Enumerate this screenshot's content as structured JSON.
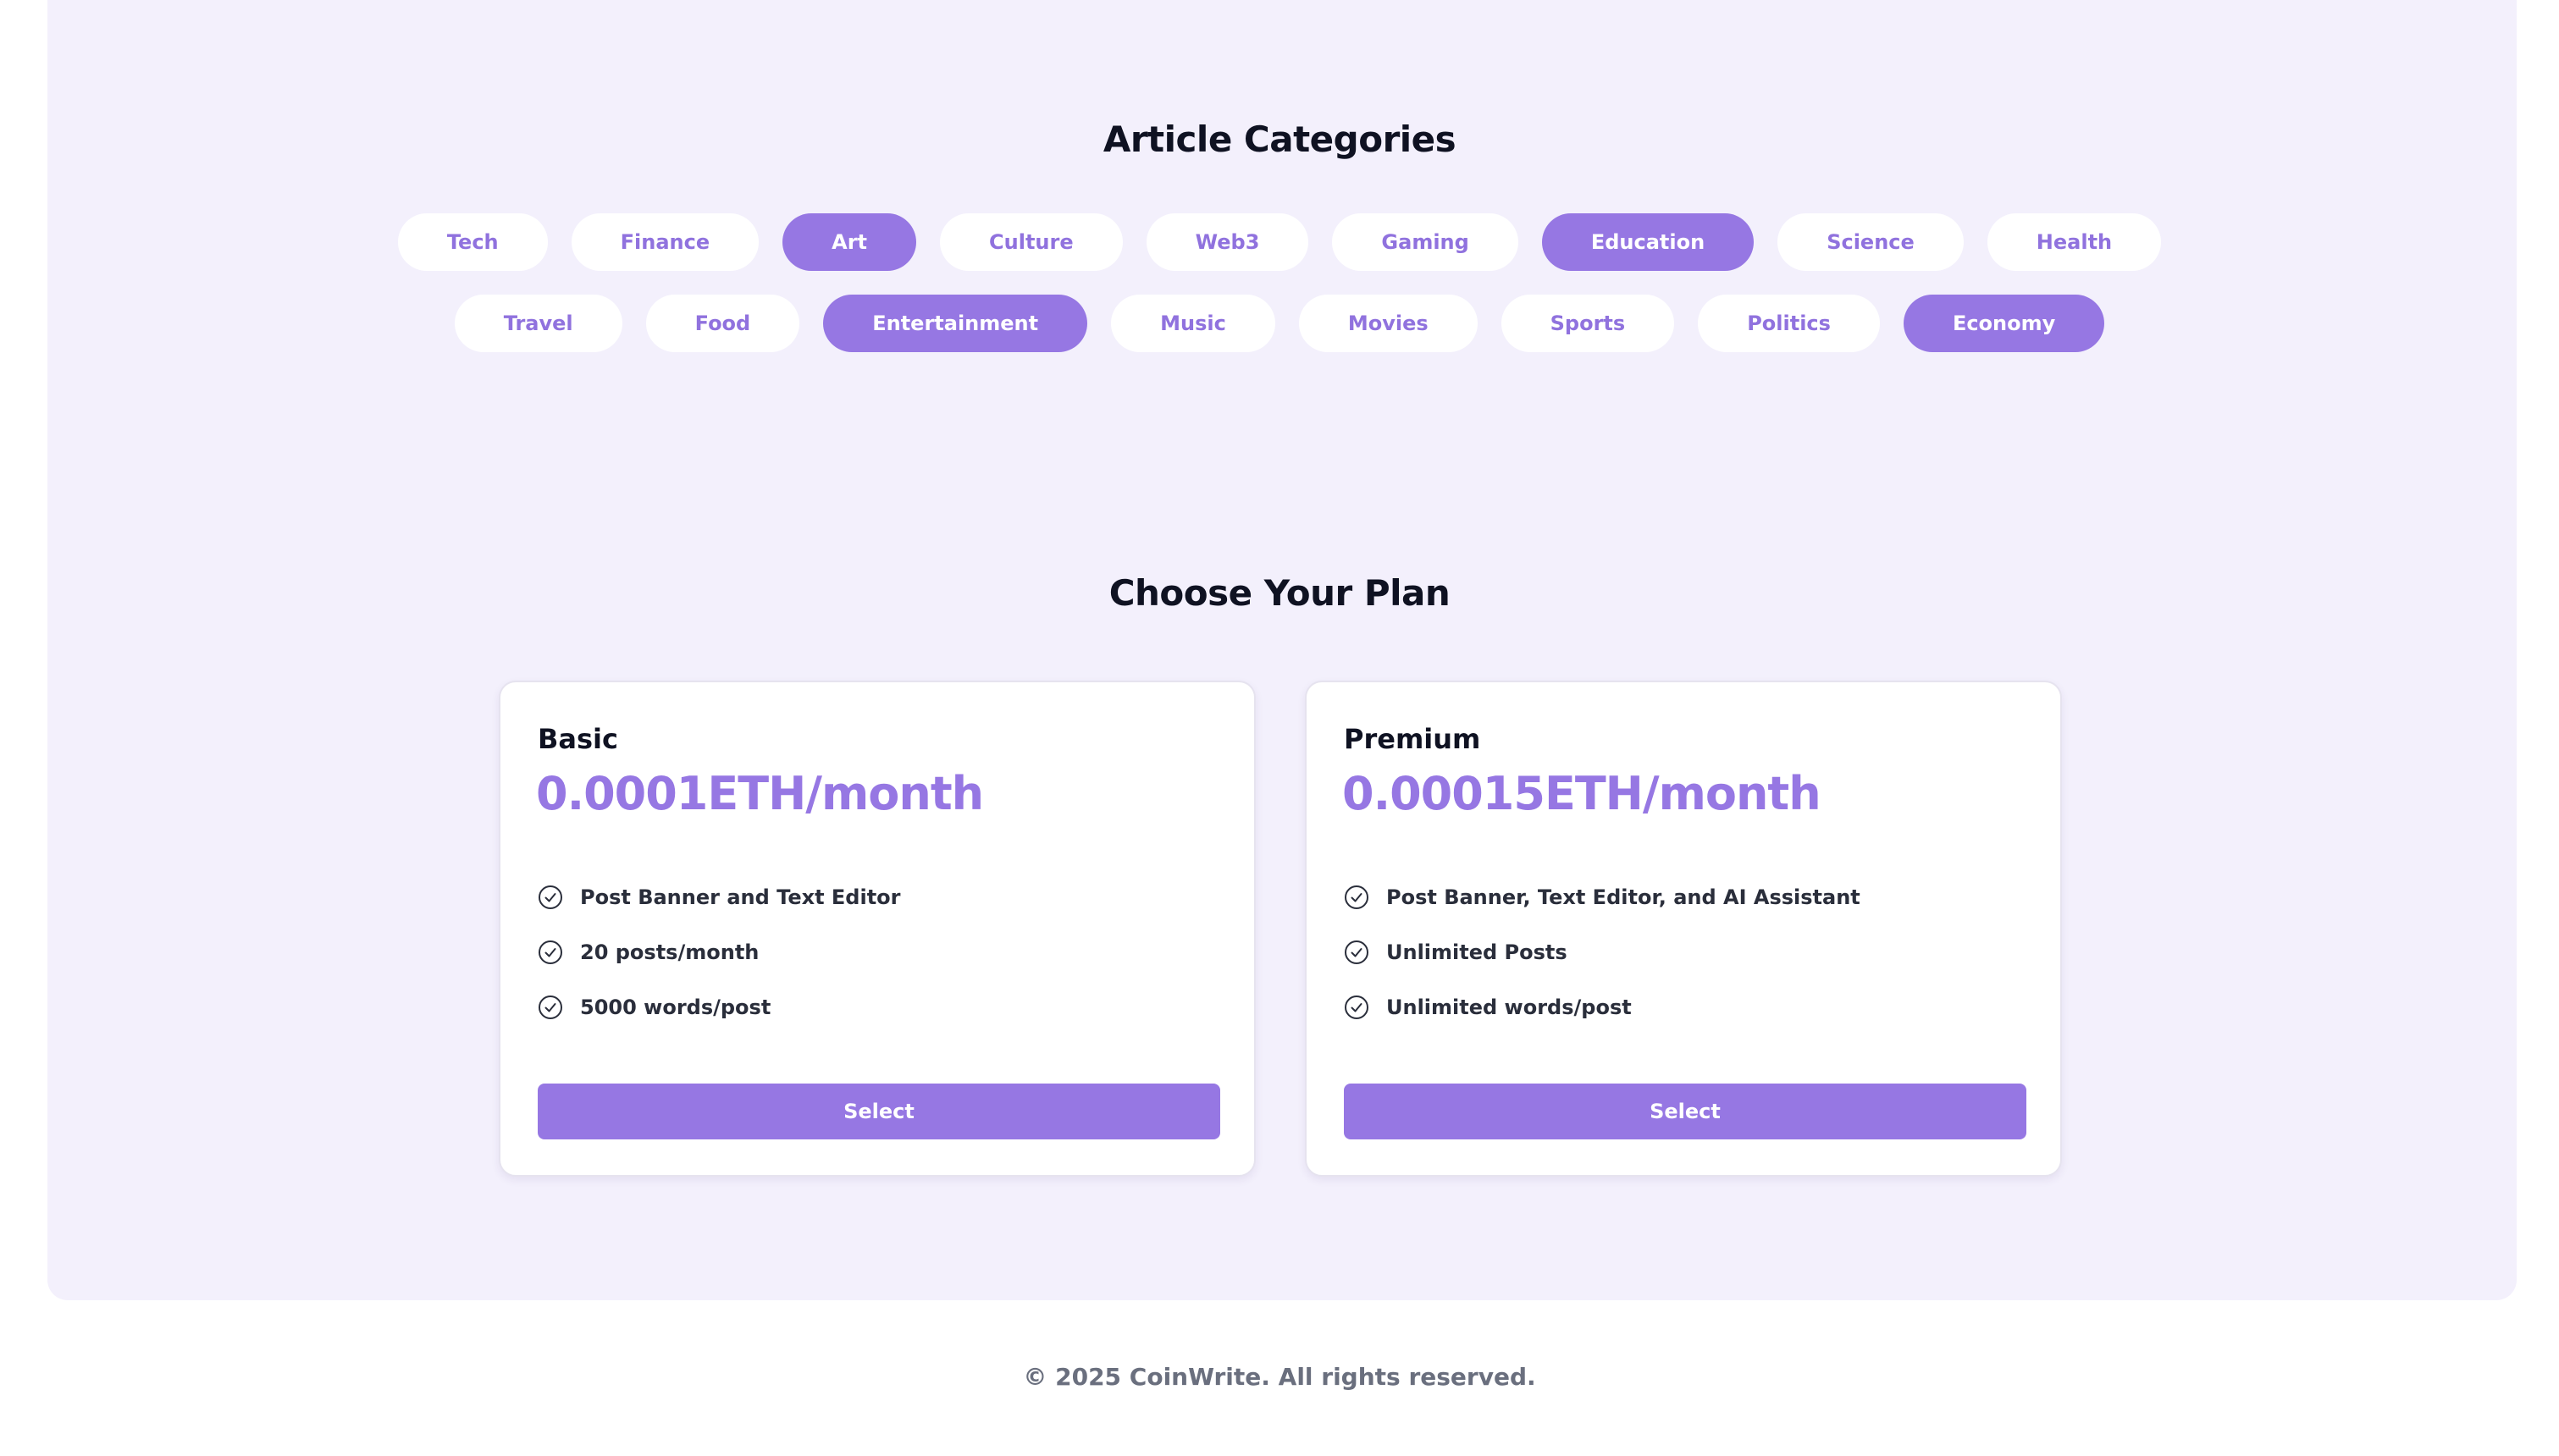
{
  "categories_section": {
    "title": "Article Categories",
    "row1": [
      {
        "label": "Tech",
        "active": false
      },
      {
        "label": "Finance",
        "active": false
      },
      {
        "label": "Art",
        "active": true
      },
      {
        "label": "Culture",
        "active": false
      },
      {
        "label": "Web3",
        "active": false
      },
      {
        "label": "Gaming",
        "active": false
      },
      {
        "label": "Education",
        "active": true
      },
      {
        "label": "Science",
        "active": false
      },
      {
        "label": "Health",
        "active": false
      }
    ],
    "row2": [
      {
        "label": "Travel",
        "active": false
      },
      {
        "label": "Food",
        "active": false
      },
      {
        "label": "Entertainment",
        "active": true
      },
      {
        "label": "Music",
        "active": false
      },
      {
        "label": "Movies",
        "active": false
      },
      {
        "label": "Sports",
        "active": false
      },
      {
        "label": "Politics",
        "active": false
      },
      {
        "label": "Economy",
        "active": true
      }
    ]
  },
  "plans_section": {
    "title": "Choose Your Plan",
    "plans": [
      {
        "name": "Basic",
        "price": "0.0001ETH/month",
        "features": [
          "Post Banner and Text Editor",
          "20 posts/month",
          "5000 words/post"
        ],
        "button_label": "Select"
      },
      {
        "name": "Premium",
        "price": "0.00015ETH/month",
        "features": [
          "Post Banner, Text Editor, and AI Assistant",
          "Unlimited Posts",
          "Unlimited words/post"
        ],
        "button_label": "Select"
      }
    ]
  },
  "footer": {
    "copyright": "© 2025 CoinWrite. All rights reserved."
  },
  "colors": {
    "accent": "#9677e3",
    "panel_bg": "#f3f0fc",
    "heading": "#0f1222"
  },
  "icons": {
    "feature": "check-circle-icon"
  }
}
